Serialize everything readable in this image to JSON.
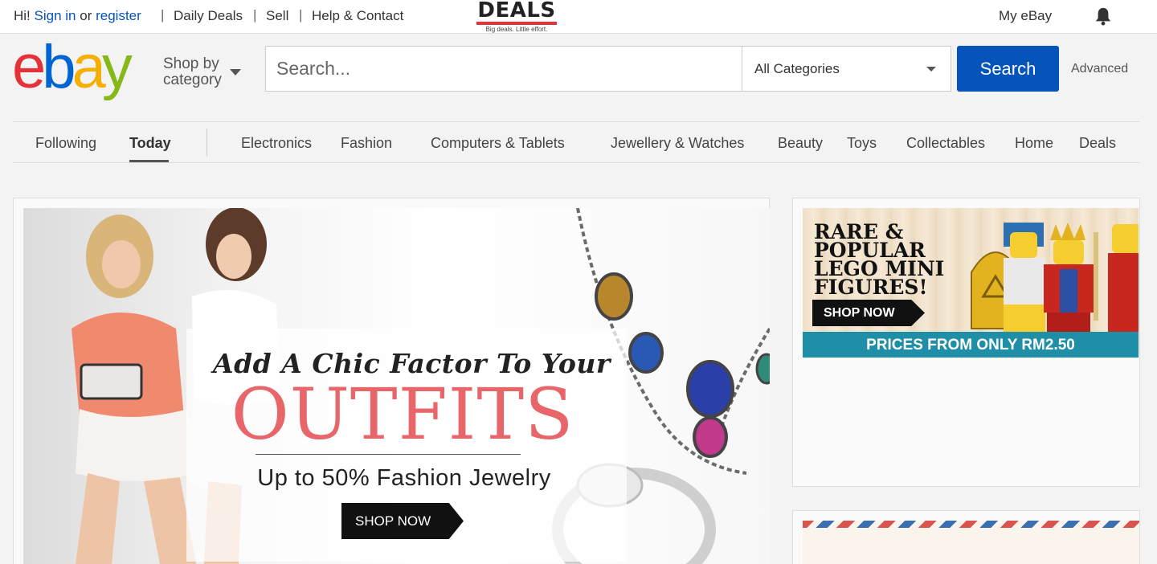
{
  "topbar": {
    "greeting": "Hi!",
    "sign_in": "Sign in",
    "or": "or",
    "register": "register",
    "links": [
      "Daily Deals",
      "Sell",
      "Help & Contact"
    ],
    "deals_logo": {
      "word": "DEALS",
      "tagline": "Big deals. Little effort."
    },
    "my_ebay": "My eBay",
    "notification_icon": "bell-icon"
  },
  "header": {
    "logo_letters": [
      "e",
      "b",
      "a",
      "y"
    ],
    "logo_colors": [
      "#e53238",
      "#0064d2",
      "#f5af02",
      "#86b817"
    ],
    "shop_by_category": "Shop by category",
    "search_placeholder": "Search...",
    "category_selected": "All Categories",
    "search_button": "Search",
    "advanced": "Advanced"
  },
  "nav": {
    "items": [
      "Following",
      "Today",
      "Electronics",
      "Fashion",
      "Computers & Tablets",
      "Jewellery & Watches",
      "Beauty",
      "Toys",
      "Collectables",
      "Home",
      "Deals"
    ],
    "active": "Today"
  },
  "main_banner": {
    "headline": "Add A Chic Factor To Your",
    "big_word": "OUTFITS",
    "subline": "Up to 50% Fashion Jewelry",
    "cta": "SHOP NOW",
    "accent": "#e8666a"
  },
  "lego_banner": {
    "title": "RARE & POPULAR LEGO MINI FIGURES!",
    "cta": "SHOP NOW",
    "price_strip": "PRICES FROM ONLY RM2.50",
    "strip_color": "#1f8fa8"
  },
  "colors": {
    "primary_blue": "#0654ba",
    "link_blue": "#0654ba"
  }
}
